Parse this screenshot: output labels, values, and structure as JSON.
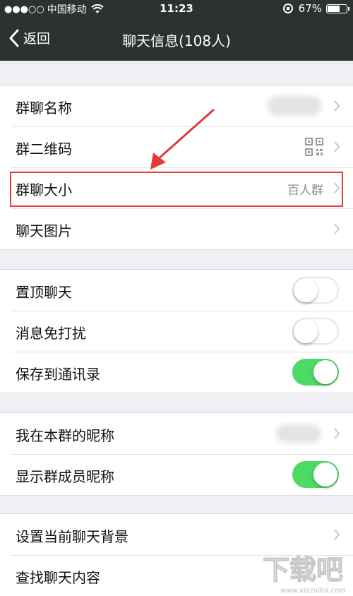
{
  "status_bar": {
    "signal": "●●●○○",
    "carrier": "中国移动",
    "time": "11:23",
    "battery": "67%",
    "battery_level": 0.67
  },
  "nav": {
    "back_label": "返回",
    "title": "聊天信息(108人)"
  },
  "group1": {
    "name_label": "群聊名称",
    "qr_label": "群二维码",
    "size_label": "群聊大小",
    "size_value": "百人群",
    "images_label": "聊天图片"
  },
  "group2": {
    "pin_label": "置顶聊天",
    "pin_on": false,
    "mute_label": "消息免打扰",
    "mute_on": false,
    "save_label": "保存到通讯录",
    "save_on": true
  },
  "group3": {
    "nickname_label": "我在本群的昵称",
    "show_nick_label": "显示群成员昵称",
    "show_nick_on": true
  },
  "group4": {
    "background_label": "设置当前聊天背景",
    "search_label": "查找聊天内容"
  },
  "watermark": {
    "text": "下载吧",
    "url": "www.xiazaiba.com"
  },
  "colors": {
    "nav_bg": "#2e3132",
    "page_bg": "#efeff4",
    "switch_on": "#4cd964",
    "highlight": "#e03c3c"
  },
  "icons": [
    "wifi-icon",
    "rotation-lock-icon",
    "battery-icon",
    "back-chevron-icon",
    "chevron-right-icon",
    "qr-code-icon",
    "red-arrow-annotation"
  ]
}
